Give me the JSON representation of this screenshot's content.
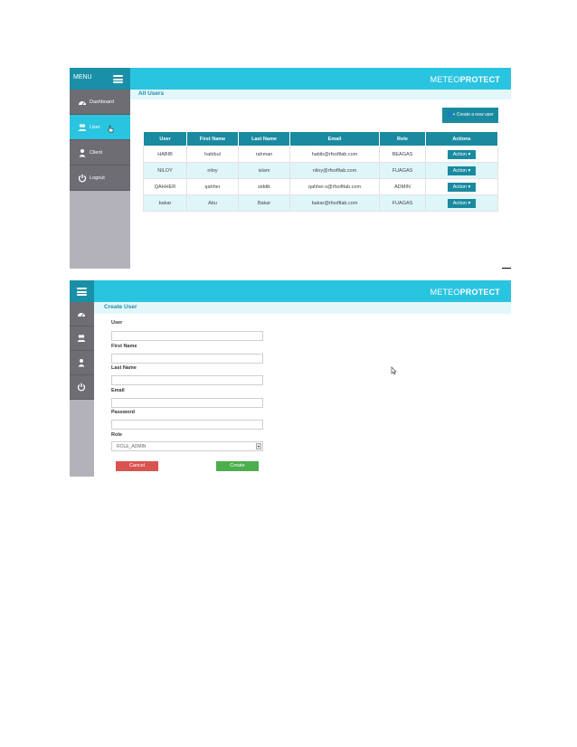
{
  "screen1": {
    "menu_label": "MENU",
    "logo": {
      "light": "METEO",
      "bold": "PROTECT"
    },
    "nav": [
      {
        "label": "Dashboard",
        "icon": "dashboard-icon"
      },
      {
        "label": "User",
        "icon": "users-icon"
      },
      {
        "label": "Client",
        "icon": "person-icon"
      },
      {
        "label": "Logout",
        "icon": "power-icon"
      }
    ],
    "page_title": "All Users",
    "create_button": "Create a new user",
    "table": {
      "headers": [
        "User",
        "First Name",
        "Last Name",
        "Email",
        "Role",
        "Actions"
      ],
      "rows": [
        [
          "HABIB",
          "habibul",
          "rahman",
          "habib@rfsoftlab.com",
          "BEAGAS"
        ],
        [
          "NILOY",
          "niloy",
          "islam",
          "niloy@rfsoftlab.com",
          "FUAGAS"
        ],
        [
          "QAHHER",
          "qahher",
          "siddik",
          "qahher.s@rfsoftlab.com",
          "ADMIN"
        ],
        [
          "bakar",
          "Abu",
          "Bakar",
          "bakar@rfsoftlab.com",
          "FUAGAS"
        ]
      ],
      "action_label": "Action"
    }
  },
  "screen2": {
    "logo": {
      "light": "METEO",
      "bold": "PROTECT"
    },
    "page_title": "Create User",
    "fields": {
      "user": "User",
      "first_name": "First Name",
      "last_name": "Last Name",
      "email": "Email",
      "password": "Password",
      "role": "Role"
    },
    "role_value": "ROLE_ADMIN",
    "cancel_button": "Cancel",
    "create_button": "Create"
  },
  "colors": {
    "accent": "#29c4e0",
    "dark_accent": "#1a8aa0",
    "sidebar": "#6e6d73",
    "danger": "#d9534f",
    "success": "#4cae4c"
  }
}
